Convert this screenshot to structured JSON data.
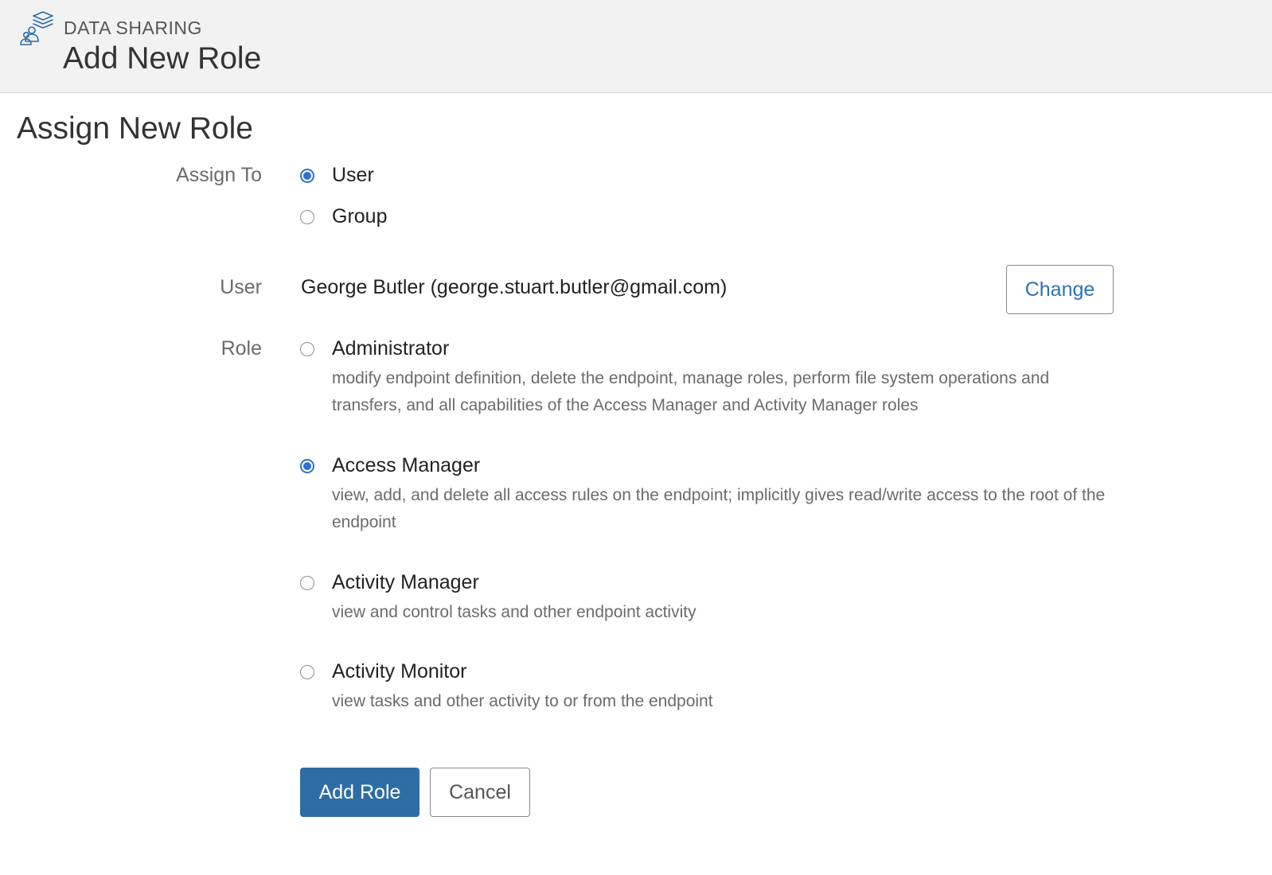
{
  "header": {
    "section": "DATA SHARING",
    "title": "Add New Role",
    "icon": "data-sharing-icon"
  },
  "form": {
    "title": "Assign New Role",
    "assign_to": {
      "label": "Assign To",
      "options": [
        {
          "label": "User",
          "checked": true
        },
        {
          "label": "Group",
          "checked": false
        }
      ]
    },
    "user": {
      "label": "User",
      "value": "George Butler (george.stuart.butler@gmail.com)",
      "change_label": "Change"
    },
    "role": {
      "label": "Role",
      "options": [
        {
          "label": "Administrator",
          "checked": false,
          "description": "modify endpoint definition, delete the endpoint, manage roles, perform file system operations and transfers, and all capabilities of the Access Manager and Activity Manager roles"
        },
        {
          "label": "Access Manager",
          "checked": true,
          "description": "view, add, and delete all access rules on the endpoint; implicitly gives read/write access to the root of the endpoint"
        },
        {
          "label": "Activity Manager",
          "checked": false,
          "description": "view and control tasks and other endpoint activity"
        },
        {
          "label": "Activity Monitor",
          "checked": false,
          "description": "view tasks and other activity to or from the endpoint"
        }
      ]
    },
    "actions": {
      "submit_label": "Add Role",
      "cancel_label": "Cancel"
    }
  },
  "colors": {
    "accent": "#2f6fd6",
    "primary_button": "#2e6da4",
    "link": "#2b73b4",
    "header_bg": "#f2f2f2"
  }
}
